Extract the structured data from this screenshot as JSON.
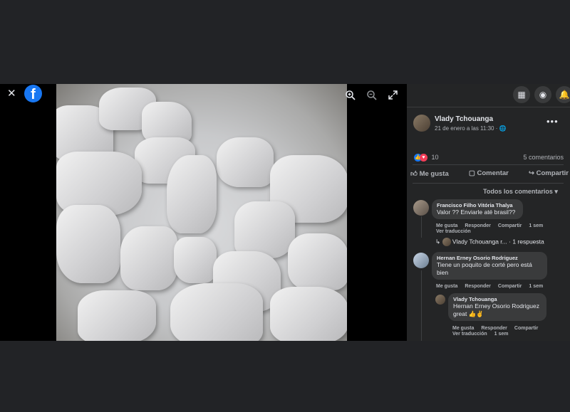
{
  "viewer": {
    "close_icon": "close-icon",
    "logo_letter": "f",
    "zoom_in_icon": "zoom-in-icon",
    "zoom_out_icon": "zoom-out-icon",
    "fullscreen_icon": "fullscreen-icon"
  },
  "post": {
    "author": "Vlady Tchouanga",
    "date": "21 de enero a las 11:30 · ",
    "privacy_icon": "globe-icon",
    "reaction_count": "10",
    "comments_count": "5 comentarios",
    "like_label": "Me gusta",
    "comment_label": "Comentar",
    "share_label": "Compartir",
    "sort_label": "Todos los comentarios"
  },
  "comments": [
    {
      "author": "Francisco Filho Vitória Thalya",
      "text": "Valor ?? Enviarle até brasil??",
      "like": "Me gusta",
      "reply": "Responder",
      "share": "Compartir",
      "time": "1 sem",
      "translate": "Ver traducción",
      "reply_preview": "Vlady Tchouanga r...",
      "reply_count": "· 1 respuesta"
    },
    {
      "author": "Hernan Erney Osorio Rodriguez",
      "text": "Tiene un poquito de corté pero está bien",
      "like": "Me gusta",
      "reply": "Responder",
      "share": "Compartir",
      "time": "1 sem"
    },
    {
      "author": "Vlady Tchouanga",
      "text": "Hernan Erney Osorio Rodriguez great 👍✌",
      "like": "Me gusta",
      "reply": "Responder",
      "share": "Compartir",
      "time": "1 sem",
      "translate": "Ver traducción"
    }
  ]
}
